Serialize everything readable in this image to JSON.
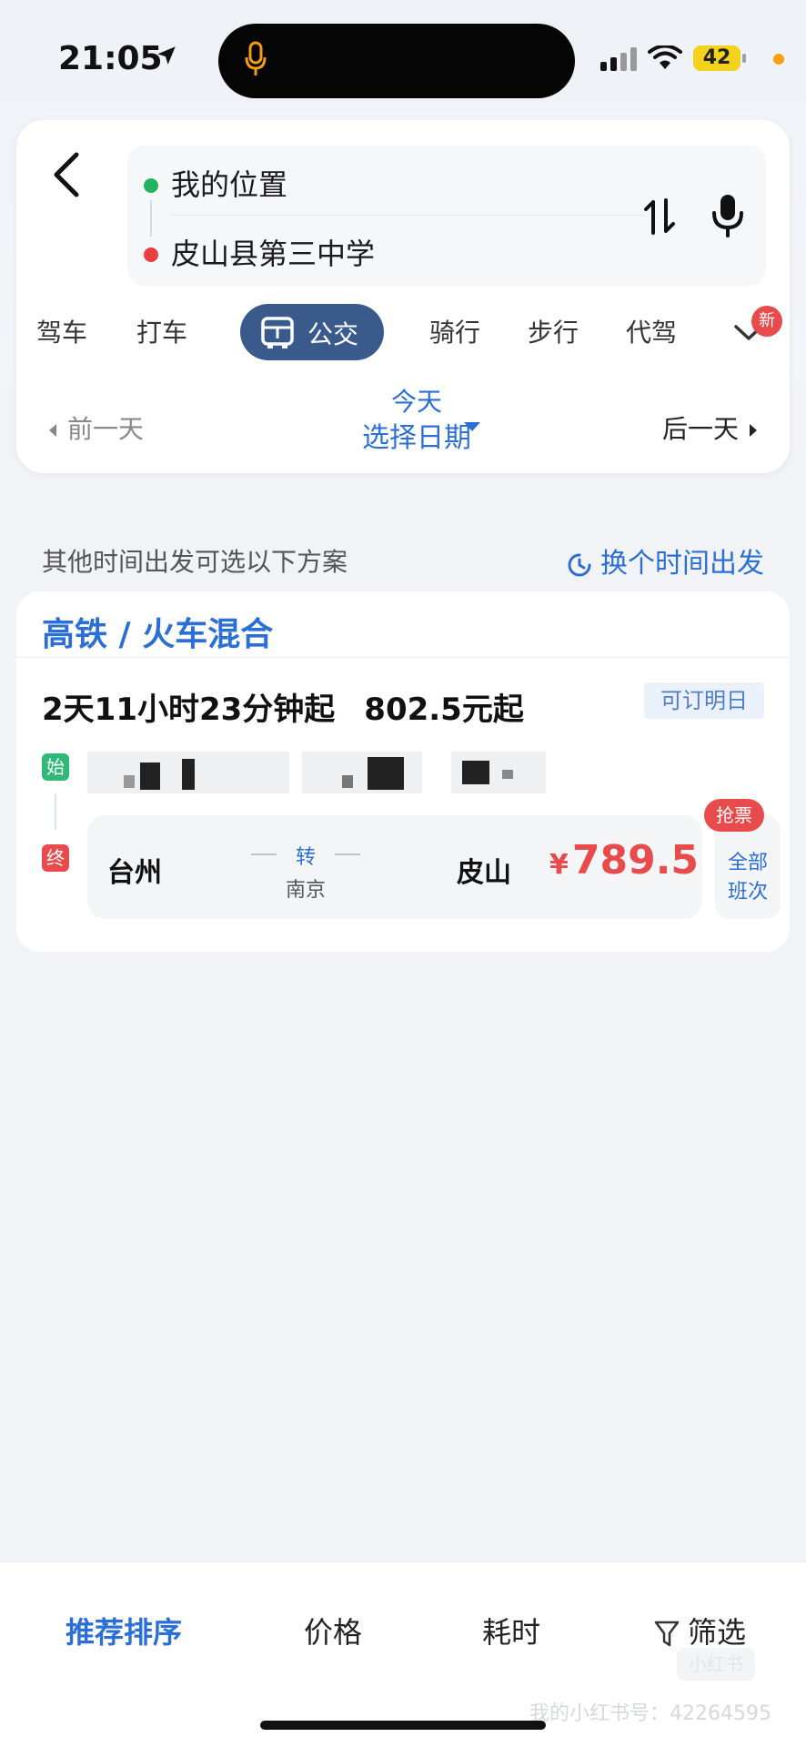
{
  "status_bar": {
    "time": "21:05",
    "battery": "42"
  },
  "route": {
    "origin": "我的位置",
    "destination": "皮山县第三中学"
  },
  "modes": [
    {
      "label": "驾车"
    },
    {
      "label": "打车"
    },
    {
      "label": "公交",
      "active": true
    },
    {
      "label": "骑行"
    },
    {
      "label": "步行"
    },
    {
      "label": "代驾"
    }
  ],
  "new_badge": "新",
  "date_nav": {
    "prev": "前一天",
    "today": "今天",
    "pick": "选择日期",
    "next": "后一天"
  },
  "section": {
    "hint": "其他时间出发可选以下方案",
    "change_time": "换个时间出发"
  },
  "result": {
    "title": "高铁 / 火车混合",
    "duration": "2天11小时23分钟起",
    "price_from": "802.5元起",
    "bookable": "可订明日",
    "start_tag": "始",
    "end_tag": "终",
    "from": "台州",
    "transfer_label": "转",
    "transfer_city": "南京",
    "to": "皮山",
    "currency": "¥",
    "price": "789.5",
    "grab": "抢票",
    "all_trips_1": "全部",
    "all_trips_2": "班次"
  },
  "sort_bar": {
    "recommended": "推荐排序",
    "price": "价格",
    "duration": "耗时",
    "filter": "筛选"
  },
  "watermark": {
    "mark": "小红书",
    "text": "我的小红书号：42264595"
  },
  "colors": {
    "accent": "#2b6fd6",
    "price": "#e84b4b",
    "active_mode": "#3a5a8c"
  }
}
